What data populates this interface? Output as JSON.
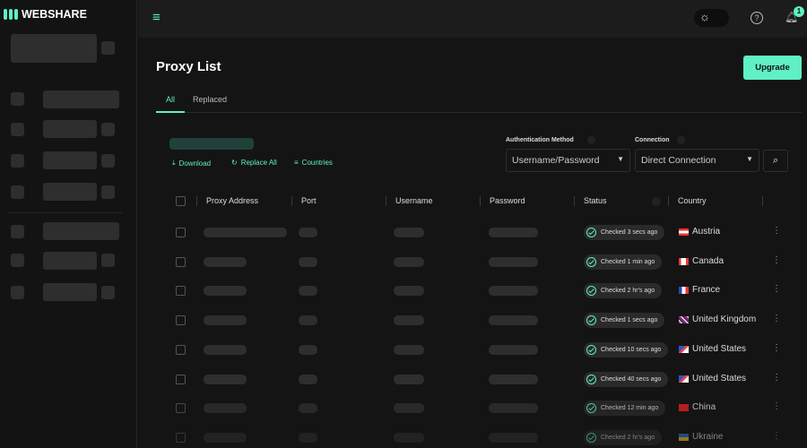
{
  "brand": {
    "name": "WEBSHARE",
    "accent": "#5ff0c5"
  },
  "header": {
    "notification_count": "1"
  },
  "page": {
    "title": "Proxy List",
    "upgrade_label": "Upgrade"
  },
  "tabs": [
    {
      "label": "All",
      "active": true
    },
    {
      "label": "Replaced",
      "active": false
    }
  ],
  "actions": {
    "download": "Download",
    "replace_all": "Replace All",
    "countries": "Countries"
  },
  "filters": {
    "auth_label": "Authentication Method",
    "auth_value": "Username/Password",
    "connection_label": "Connection",
    "connection_value": "Direct Connection"
  },
  "table": {
    "columns": [
      "Proxy Address",
      "Port",
      "Username",
      "Password",
      "Status",
      "Country"
    ],
    "rows": [
      {
        "status": "Checked 3 secs ago",
        "country": "Austria",
        "flag": "austria"
      },
      {
        "status": "Checked 1 min ago",
        "country": "Canada",
        "flag": "canada"
      },
      {
        "status": "Checked 2 hr's ago",
        "country": "France",
        "flag": "france"
      },
      {
        "status": "Checked 1 secs ago",
        "country": "United Kingdom",
        "flag": "uk"
      },
      {
        "status": "Checked 10 secs ago",
        "country": "United States",
        "flag": "us"
      },
      {
        "status": "Checked 40 secs ago",
        "country": "United States",
        "flag": "us"
      },
      {
        "status": "Checked 12 min ago",
        "country": "China",
        "flag": "china"
      },
      {
        "status": "Checked 2 hr's ago",
        "country": "Ukraine",
        "flag": "ukraine"
      }
    ]
  }
}
